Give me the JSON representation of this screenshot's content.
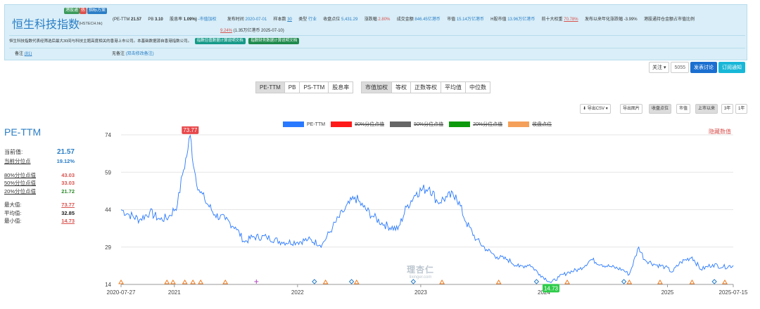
{
  "header": {
    "tags": [
      "港股通",
      "热",
      "指标方案"
    ],
    "index_name": "恒生科技指数",
    "index_code": "(HSTECH.hk)",
    "stats": {
      "pe_label": "(PE-TTM",
      "pe_value": "21.57",
      "pb_label": "PB",
      "pb_value": "3.10",
      "div_label": "股息率",
      "div_value": "1.09%)",
      "mcap_weight": "-市值加权",
      "release_label": "发布时间",
      "release_value": "2020-07-01",
      "sample_label": "样本数",
      "sample_value": "30",
      "type_label": "类型",
      "type_value": "行业",
      "close_label": "收盘点位",
      "close_value": "5,431.29",
      "change_label": "涨跌幅",
      "change_value": "2.80%",
      "turnover_label": "成交金额",
      "turnover_value": "846.45亿港币",
      "mv_label": "市值",
      "mv_value": "15.14万亿港币",
      "hmv_label": "H股市值",
      "hmv_value": "13.96万亿港币",
      "top10_label": "前十大权重",
      "top10_value": "70.78%",
      "annual_label": "发布以来年化涨跌幅",
      "annual_value": "-3.99%",
      "connect_label": "港股通持仓金额占市值比例",
      "connect_value": "9.24%",
      "connect_detail": "(1.35万亿港币",
      "connect_date": "2025-07-10)"
    },
    "description": "恒生科技指数代表经筛选后最大30间与科技主题高度相关的香港上市公司。本基础数据源自香港指数公司。",
    "doc_btn_1": "指数估值数据计算说明文档",
    "doc_btn_2": "指数财务数据计算说明文档",
    "note_left": "备注",
    "note_left_count": "(81)",
    "note_right": "无备注",
    "note_right_link": "(双击修改备注)"
  },
  "follow_bar": {
    "follow_label": "关注 ▾",
    "follow_count": "5055",
    "discuss_label": "发表讨论",
    "subscribe_label": "订阅通知"
  },
  "metric_tabs": [
    "PE-TTM",
    "PB",
    "PS-TTM",
    "股息率"
  ],
  "weight_tabs": [
    "市值加权",
    "等权",
    "正数等权",
    "平均值",
    "中位数"
  ],
  "toolbar": {
    "export_csv": "导出CSV ▾",
    "export_img": "导出图片",
    "close_point": "收盘点位",
    "market_value": "市值",
    "since_listing": "上市以来",
    "three_year": "3年",
    "one_year": "1年"
  },
  "legend": [
    {
      "label": "PE-TTM",
      "color": "#2979ff",
      "off": false
    },
    {
      "label": "80%分位点值",
      "color": "#ff1a1a",
      "off": true
    },
    {
      "label": "50%分位点值",
      "color": "#666666",
      "off": true
    },
    {
      "label": "20%分位点值",
      "color": "#0c9a0c",
      "off": true
    },
    {
      "label": "收盘点位",
      "color": "#f5a05a",
      "off": true
    }
  ],
  "top_right_label": "隐藏数值",
  "side_stats": {
    "title": "PE-TTM",
    "current_label": "当前值:",
    "current_value": "21.57",
    "pct_label": "当前分位点",
    "pct_value": "19.12%",
    "p80_label": "80%分位点值",
    "p80_value": "43.03",
    "p50_label": "50%分位点值",
    "p50_value": "33.03",
    "p20_label": "20%分位点值",
    "p20_value": "21.72",
    "max_label": "最大值:",
    "max_value": "73.77",
    "avg_label": "平均值:",
    "avg_value": "32.85",
    "min_label": "最小值:",
    "min_value": "14.73"
  },
  "watermark": {
    "main": "理杏仁",
    "sub": "lixinger.com"
  },
  "chart_data": {
    "type": "line",
    "series": [
      {
        "name": "PE-TTM",
        "color": "#2979ff"
      }
    ],
    "x_tick_labels": [
      "2020-07-27",
      "2021",
      "2022",
      "2023",
      "2024",
      "2025",
      "2025-07-15"
    ],
    "x_tick_dates": [
      "2020-07-27",
      "2021-01-01",
      "2022-01-01",
      "2023-01-01",
      "2024-01-01",
      "2025-01-01",
      "2025-07-15"
    ],
    "y_ticks": [
      14,
      29,
      44,
      59,
      74
    ],
    "ylim": [
      14,
      74
    ],
    "xlim": [
      "2020-07-27",
      "2025-07-15"
    ],
    "max_marker": {
      "label": "73.77",
      "date": "2021-02-17",
      "value": 73.77
    },
    "min_marker": {
      "label": "14.73",
      "date": "2024-01-22",
      "value": 14.73
    },
    "points": [
      [
        "2020-07-27",
        44
      ],
      [
        "2020-08-20",
        42
      ],
      [
        "2020-09-20",
        40
      ],
      [
        "2020-10-20",
        43
      ],
      [
        "2020-11-20",
        40
      ],
      [
        "2020-12-15",
        41
      ],
      [
        "2021-01-10",
        46
      ],
      [
        "2021-01-25",
        58
      ],
      [
        "2021-02-10",
        68
      ],
      [
        "2021-02-17",
        73.77
      ],
      [
        "2021-03-01",
        60
      ],
      [
        "2021-03-15",
        52
      ],
      [
        "2021-04-01",
        48
      ],
      [
        "2021-05-01",
        42
      ],
      [
        "2021-06-01",
        40
      ],
      [
        "2021-07-01",
        37
      ],
      [
        "2021-07-28",
        31
      ],
      [
        "2021-08-20",
        33
      ],
      [
        "2021-10-01",
        33
      ],
      [
        "2021-11-15",
        31
      ],
      [
        "2022-01-01",
        31
      ],
      [
        "2022-02-01",
        32
      ],
      [
        "2022-03-15",
        30
      ],
      [
        "2022-04-15",
        37
      ],
      [
        "2022-05-15",
        43
      ],
      [
        "2022-06-20",
        49
      ],
      [
        "2022-07-15",
        45
      ],
      [
        "2022-08-15",
        41
      ],
      [
        "2022-09-15",
        38
      ],
      [
        "2022-10-25",
        36
      ],
      [
        "2022-11-20",
        45
      ],
      [
        "2022-12-20",
        51
      ],
      [
        "2023-01-27",
        53
      ],
      [
        "2023-02-20",
        47
      ],
      [
        "2023-03-20",
        49
      ],
      [
        "2023-04-15",
        50
      ],
      [
        "2023-05-15",
        39
      ],
      [
        "2023-06-15",
        32
      ],
      [
        "2023-07-15",
        28
      ],
      [
        "2023-08-15",
        25
      ],
      [
        "2023-09-15",
        24
      ],
      [
        "2023-10-20",
        21
      ],
      [
        "2023-11-20",
        22
      ],
      [
        "2023-12-20",
        18
      ],
      [
        "2024-01-22",
        14.73
      ],
      [
        "2024-02-15",
        17
      ],
      [
        "2024-03-15",
        19
      ],
      [
        "2024-04-15",
        20
      ],
      [
        "2024-05-20",
        24
      ],
      [
        "2024-06-20",
        22
      ],
      [
        "2024-07-20",
        21
      ],
      [
        "2024-08-20",
        20
      ],
      [
        "2024-09-10",
        18
      ],
      [
        "2024-10-08",
        29
      ],
      [
        "2024-10-25",
        24
      ],
      [
        "2024-11-25",
        22
      ],
      [
        "2024-12-25",
        21
      ],
      [
        "2025-01-15",
        19
      ],
      [
        "2025-02-10",
        23
      ],
      [
        "2025-03-15",
        25
      ],
      [
        "2025-04-10",
        20
      ],
      [
        "2025-05-15",
        22
      ],
      [
        "2025-06-15",
        21
      ],
      [
        "2025-07-15",
        21.57
      ]
    ],
    "events": [
      {
        "date": "2020-07-27",
        "kind": "tri"
      },
      {
        "date": "2020-12-10",
        "kind": "tri"
      },
      {
        "date": "2020-12-28",
        "kind": "tri"
      },
      {
        "date": "2021-02-01",
        "kind": "tri"
      },
      {
        "date": "2021-02-25",
        "kind": "tri"
      },
      {
        "date": "2021-03-20",
        "kind": "tri"
      },
      {
        "date": "2021-06-01",
        "kind": "tri"
      },
      {
        "date": "2021-09-01",
        "kind": "plus"
      },
      {
        "date": "2022-02-20",
        "kind": "dia"
      },
      {
        "date": "2022-03-25",
        "kind": "tri"
      },
      {
        "date": "2022-06-10",
        "kind": "dia"
      },
      {
        "date": "2022-06-25",
        "kind": "tri"
      },
      {
        "date": "2022-12-10",
        "kind": "dia"
      },
      {
        "date": "2023-03-05",
        "kind": "tri"
      },
      {
        "date": "2023-08-20",
        "kind": "tri"
      },
      {
        "date": "2023-12-10",
        "kind": "dia"
      },
      {
        "date": "2024-03-10",
        "kind": "tri"
      },
      {
        "date": "2024-08-25",
        "kind": "dia"
      },
      {
        "date": "2024-09-10",
        "kind": "tri"
      },
      {
        "date": "2024-12-10",
        "kind": "tri"
      },
      {
        "date": "2025-03-15",
        "kind": "tri"
      },
      {
        "date": "2025-05-20",
        "kind": "dia"
      },
      {
        "date": "2025-06-20",
        "kind": "tri"
      }
    ]
  }
}
